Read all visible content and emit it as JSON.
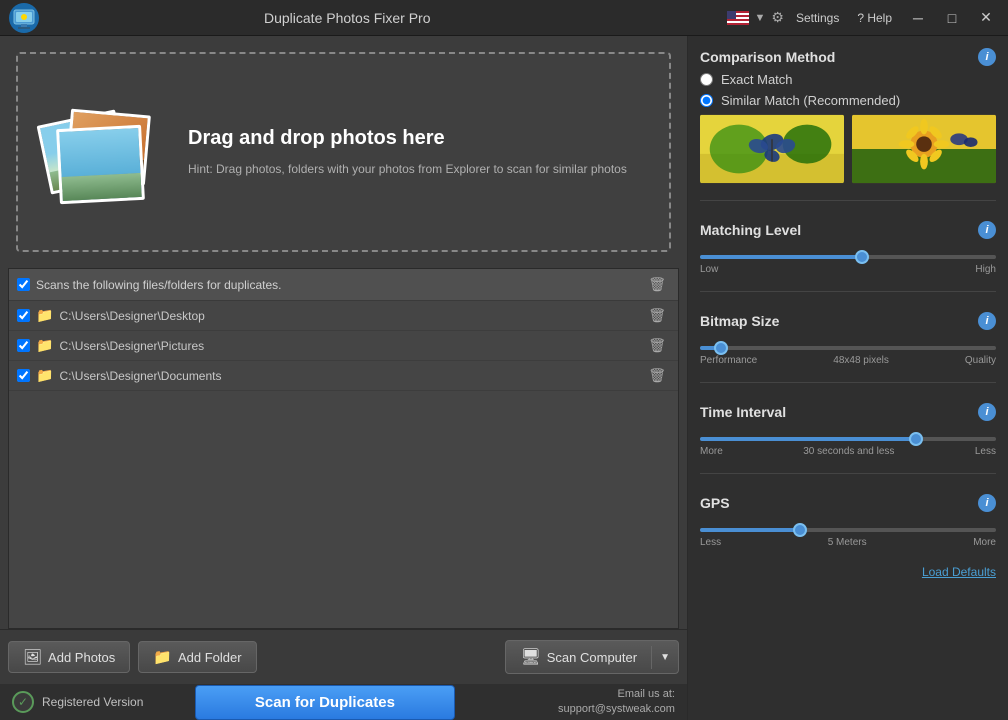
{
  "window": {
    "title": "Duplicate Photos Fixer Pro",
    "settings_btn": "Settings",
    "help_btn": "? Help"
  },
  "comparison": {
    "section_title": "Comparison Method",
    "exact_match": "Exact Match",
    "similar_match": "Similar Match (Recommended)",
    "selected": "similar"
  },
  "matching_level": {
    "title": "Matching Level",
    "low_label": "Low",
    "high_label": "High",
    "value_pct": 55
  },
  "bitmap_size": {
    "title": "Bitmap Size",
    "performance_label": "Performance",
    "quality_label": "Quality",
    "value_label": "48x48 pixels",
    "value_pct": 5
  },
  "time_interval": {
    "title": "Time Interval",
    "more_label": "More",
    "less_label": "Less",
    "value_label": "30 seconds and less",
    "value_pct": 74
  },
  "gps": {
    "title": "GPS",
    "less_label": "Less",
    "more_label": "More",
    "value_label": "5 Meters",
    "value_pct": 33
  },
  "load_defaults": "Load Defaults",
  "drop_zone": {
    "title": "Drag and drop photos here",
    "hint": "Hint: Drag photos, folders with your photos from Explorer to scan for similar photos"
  },
  "file_list": {
    "header": "Scans the following files/folders for duplicates.",
    "items": [
      {
        "path": "C:\\Users\\Designer\\Desktop",
        "checked": true
      },
      {
        "path": "C:\\Users\\Designer\\Pictures",
        "checked": true
      },
      {
        "path": "C:\\Users\\Designer\\Documents",
        "checked": true
      }
    ]
  },
  "buttons": {
    "add_photos": "Add Photos",
    "add_folder": "Add Folder",
    "scan_computer": "Scan Computer",
    "scan_for_duplicates": "Scan for Duplicates"
  },
  "status": {
    "registered": "Registered Version",
    "email_label": "Email us at:",
    "email": "support@systweak.com"
  }
}
